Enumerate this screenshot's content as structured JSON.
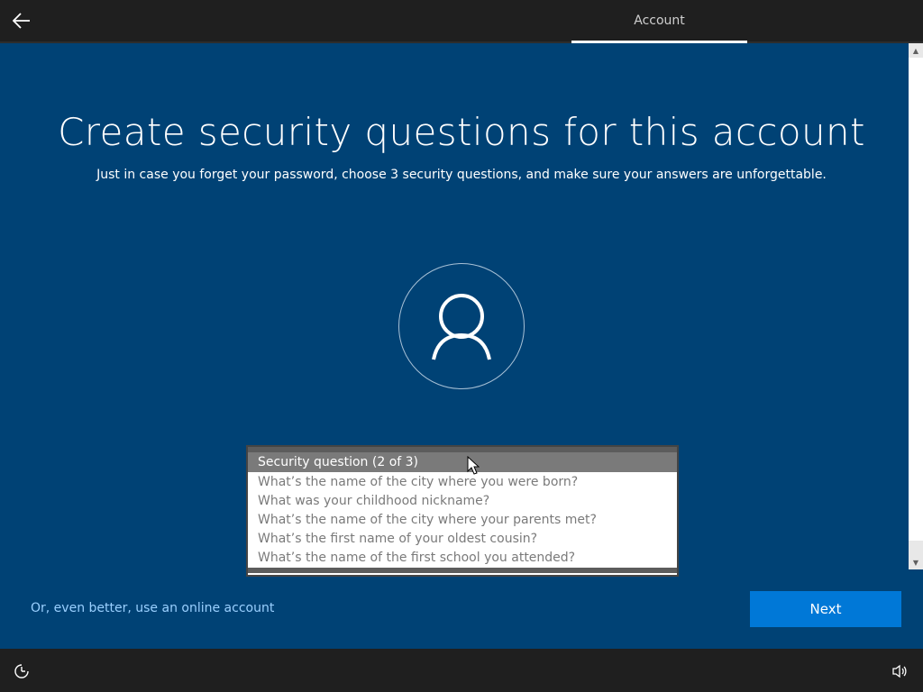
{
  "header": {
    "tab_label": "Account"
  },
  "main": {
    "title": "Create security questions for this account",
    "subtitle": "Just in case you forget your password, choose 3 security questions, and make sure your answers are unforgettable."
  },
  "dropdown": {
    "selected": "Security question (2 of 3)",
    "options": [
      "What’s the name of the city where you were born?",
      "What was your childhood nickname?",
      "What’s the name of the city where your parents met?",
      "What’s the first name of your oldest cousin?",
      "What’s the name of the first school you attended?"
    ]
  },
  "footer": {
    "online_account_link": "Or, even better, use an online account",
    "next_label": "Next"
  },
  "colors": {
    "background": "#004275",
    "accent": "#0078d7",
    "link": "#9ad0ff"
  },
  "icons": {
    "back": "back-arrow-icon",
    "avatar": "user-icon",
    "ease_of_access": "ease-of-access-icon",
    "volume": "volume-icon"
  }
}
